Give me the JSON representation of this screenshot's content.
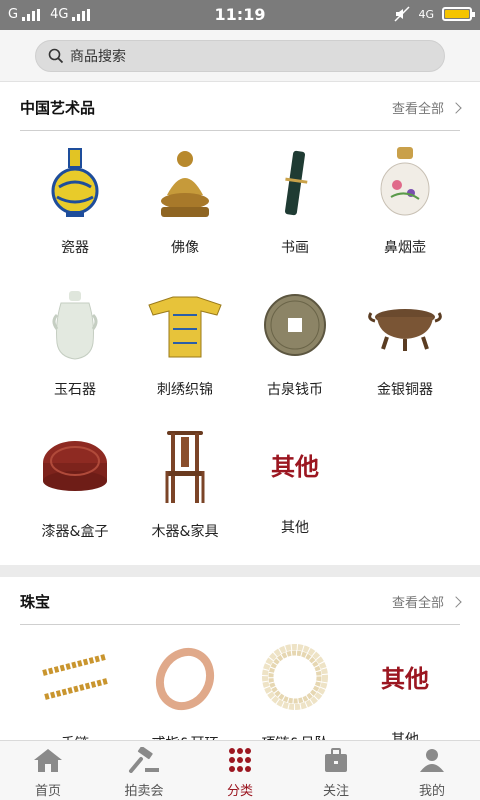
{
  "status": {
    "left": "G",
    "network": "4G",
    "time": "11:19",
    "right": "4G"
  },
  "search": {
    "placeholder": "商品搜索"
  },
  "sections": [
    {
      "title": "中国艺术品",
      "more": "查看全部",
      "items": [
        {
          "label": "瓷器",
          "icon": "porcelain-vase"
        },
        {
          "label": "佛像",
          "icon": "buddha-statue"
        },
        {
          "label": "书画",
          "icon": "scroll"
        },
        {
          "label": "鼻烟壶",
          "icon": "snuff-bottle"
        },
        {
          "label": "玉石器",
          "icon": "jade-vase"
        },
        {
          "label": "刺绣织锦",
          "icon": "embroidered-robe"
        },
        {
          "label": "古泉钱币",
          "icon": "ancient-coin"
        },
        {
          "label": "金银铜器",
          "icon": "bronze-censer"
        },
        {
          "label": "漆器&盒子",
          "icon": "lacquer-box"
        },
        {
          "label": "木器&家具",
          "icon": "wooden-chair"
        },
        {
          "label": "其他",
          "image_text": "其他"
        }
      ]
    },
    {
      "title": "珠宝",
      "more": "查看全部",
      "items": [
        {
          "label": "手链",
          "icon": "gold-bracelet"
        },
        {
          "label": "戒指&耳环",
          "icon": "gold-ring"
        },
        {
          "label": "项链&吊坠",
          "icon": "pearl-necklace"
        },
        {
          "label": "其他",
          "image_text": "其他"
        }
      ]
    }
  ],
  "tabs": [
    {
      "label": "首页",
      "icon": "home-icon"
    },
    {
      "label": "拍卖会",
      "icon": "gavel-icon"
    },
    {
      "label": "分类",
      "icon": "grid-dots-icon",
      "active": true
    },
    {
      "label": "关注",
      "icon": "briefcase-icon"
    },
    {
      "label": "我的",
      "icon": "user-icon"
    }
  ],
  "colors": {
    "accent": "#9b1620",
    "statusbar": "#7b7b7b",
    "battery": "#f5c400"
  }
}
